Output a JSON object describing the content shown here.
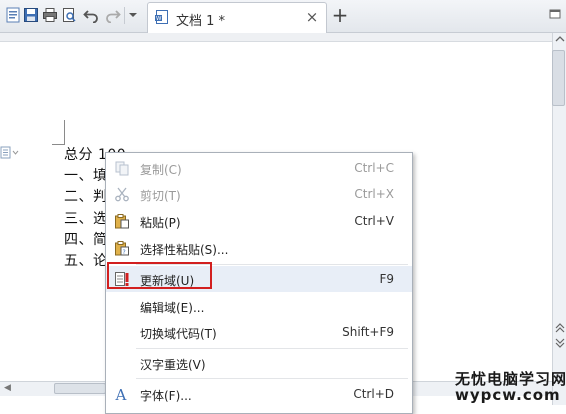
{
  "tab": {
    "title": "文档 1 *",
    "close": "×"
  },
  "new_tab": "+",
  "document": {
    "lines": [
      "总分 100",
      "一、填",
      "二、判",
      "三、选",
      "四、简",
      "五、论"
    ]
  },
  "context_menu": {
    "items": [
      {
        "label": "复制(C)",
        "shortcut": "Ctrl+C",
        "icon": "copy-icon",
        "disabled": true
      },
      {
        "label": "剪切(T)",
        "shortcut": "Ctrl+X",
        "icon": "cut-icon",
        "disabled": true
      },
      {
        "label": "粘贴(P)",
        "shortcut": "Ctrl+V",
        "icon": "paste-icon",
        "disabled": false
      },
      {
        "label": "选择性粘贴(S)...",
        "shortcut": "",
        "icon": "paste-special-icon",
        "disabled": false
      },
      {
        "label": "更新域(U)",
        "shortcut": "F9",
        "icon": "update-field-icon",
        "disabled": false,
        "highlighted": true
      },
      {
        "label": "编辑域(E)...",
        "shortcut": "",
        "icon": "",
        "disabled": false
      },
      {
        "label": "切换域代码(T)",
        "shortcut": "Shift+F9",
        "icon": "",
        "disabled": false
      },
      {
        "label": "汉字重选(V)",
        "shortcut": "",
        "icon": "",
        "disabled": false
      },
      {
        "label": "字体(F)...",
        "shortcut": "Ctrl+D",
        "icon": "font-icon",
        "disabled": false
      }
    ]
  },
  "watermark": {
    "line1": "无忧电脑学习网",
    "line2": "wypcw.com"
  },
  "colors": {
    "highlight_border": "#d21f1f",
    "menu_hover": "#e8eef7"
  }
}
